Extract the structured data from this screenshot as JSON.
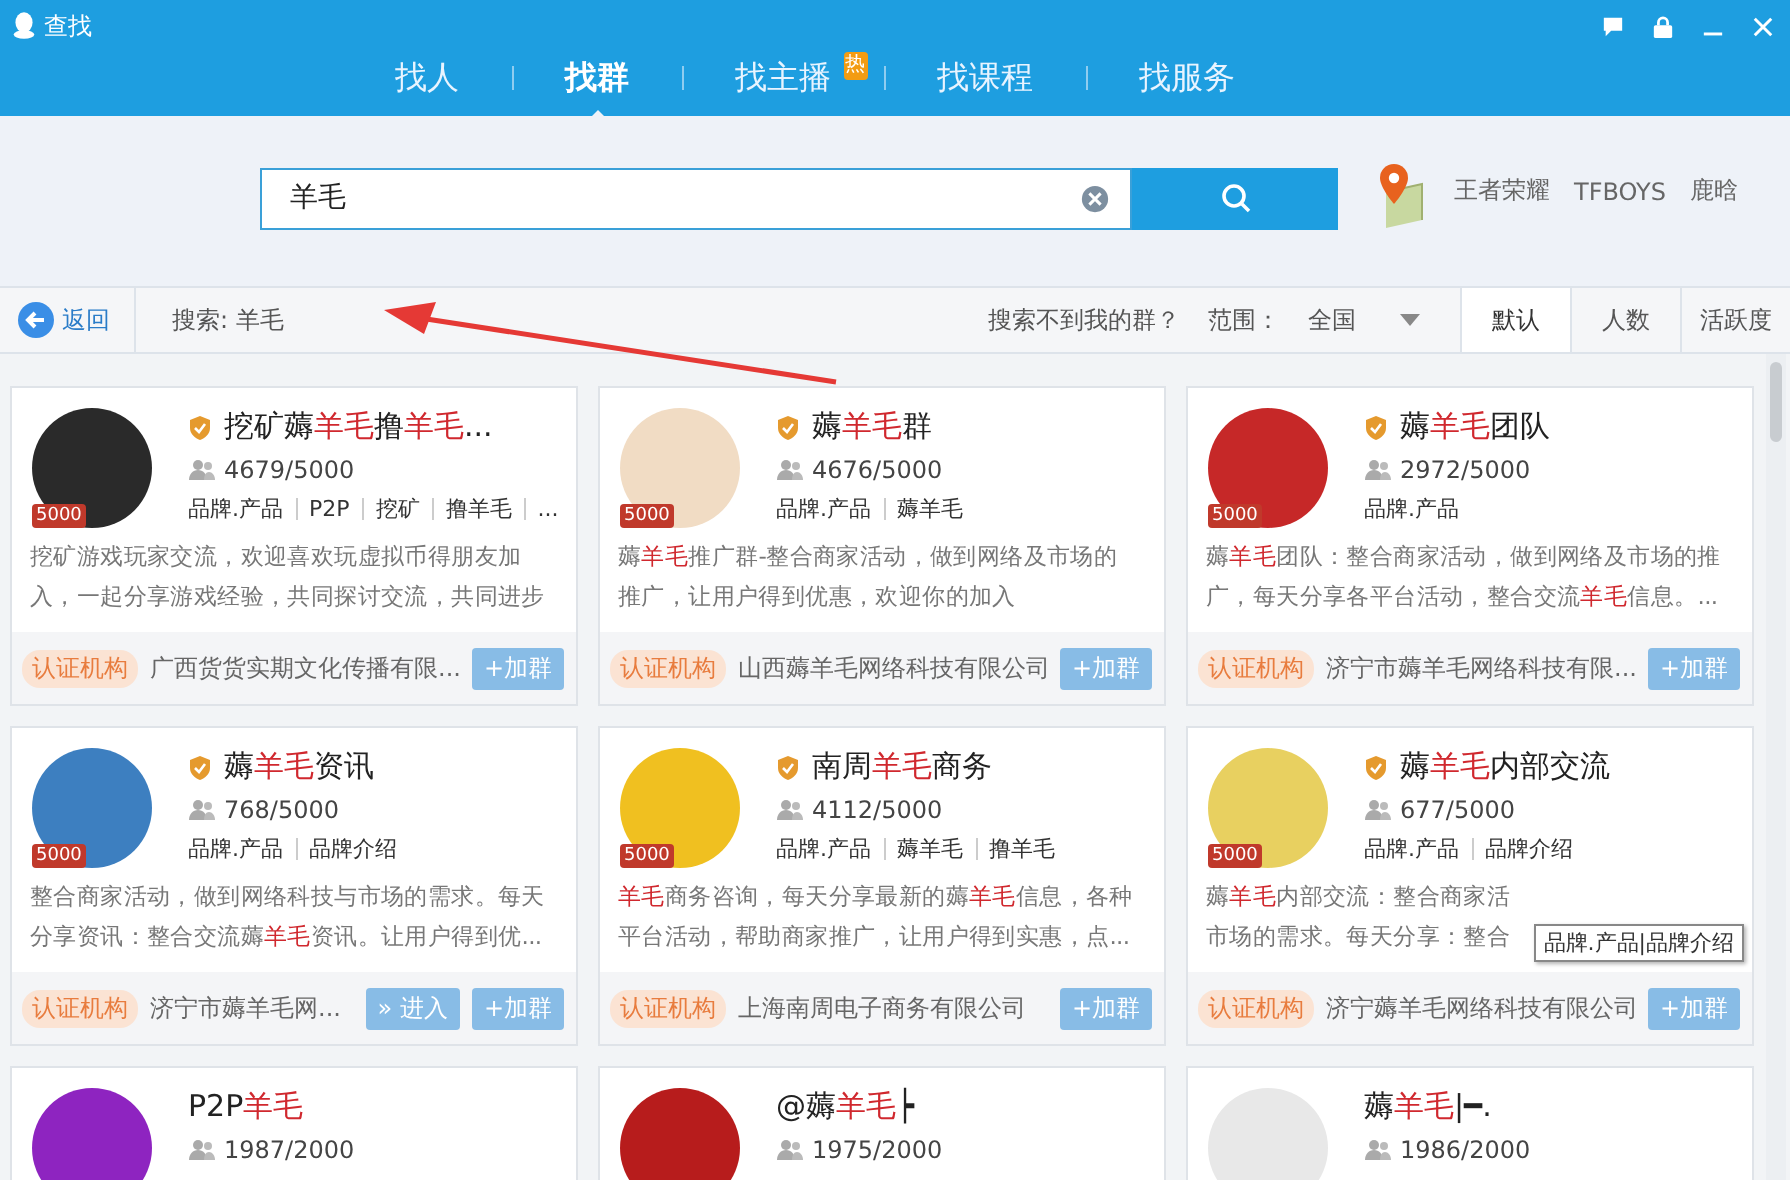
{
  "window": {
    "title": "查找"
  },
  "nav_tabs": [
    {
      "label": "找人",
      "selected": false
    },
    {
      "label": "找群",
      "selected": true
    },
    {
      "label": "找主播",
      "selected": false,
      "badge": "热"
    },
    {
      "label": "找课程",
      "selected": false
    },
    {
      "label": "找服务",
      "selected": false
    }
  ],
  "search": {
    "value": "羊毛"
  },
  "hot_keywords": [
    "王者荣耀",
    "TFBOYS",
    "鹿晗"
  ],
  "toolbar": {
    "back": "返回",
    "query": "搜索: 羊毛",
    "help_link": "搜索不到我的群？",
    "range_label": "范围：",
    "range_value": "全国",
    "sort_tabs": [
      {
        "label": "默认",
        "selected": true
      },
      {
        "label": "人数",
        "selected": false
      },
      {
        "label": "活跃度",
        "selected": false
      }
    ]
  },
  "cards": [
    {
      "name": [
        {
          "text": "挖矿薅",
          "highlight": false
        },
        {
          "text": "羊毛",
          "highlight": true
        },
        {
          "text": "撸",
          "highlight": false
        },
        {
          "text": "羊毛",
          "highlight": true
        },
        {
          "text": "...",
          "highlight": false
        }
      ],
      "verified": true,
      "badge": "5000",
      "members": "4679/5000",
      "tags": [
        "品牌.产品",
        "P2P",
        "挖矿",
        "撸羊毛",
        "..."
      ],
      "description": [
        [
          {
            "text": "挖矿游戏玩家交流，欢迎喜欢玩虚拟币得朋友加",
            "highlight": false
          }
        ],
        [
          {
            "text": "入，一起分享游戏经验，共同探讨交流，共同进步",
            "highlight": false
          }
        ]
      ],
      "org_label": "认证机构",
      "org": "广西货货实期文化传播有限...",
      "buttons": [
        "+加群"
      ]
    },
    {
      "name": [
        {
          "text": "薅",
          "highlight": false
        },
        {
          "text": "羊毛",
          "highlight": true
        },
        {
          "text": "群",
          "highlight": false
        }
      ],
      "verified": true,
      "badge": "5000",
      "members": "4676/5000",
      "tags": [
        "品牌.产品",
        "薅羊毛"
      ],
      "description": [
        [
          {
            "text": "薅",
            "highlight": false
          },
          {
            "text": "羊毛",
            "highlight": true
          },
          {
            "text": "推广群-整合商家活动，做到网络及市场的",
            "highlight": false
          }
        ],
        [
          {
            "text": "推广，让用户得到优惠，欢迎你的加入",
            "highlight": false
          }
        ]
      ],
      "org_label": "认证机构",
      "org": "山西薅羊毛网络科技有限公司",
      "buttons": [
        "+加群"
      ]
    },
    {
      "name": [
        {
          "text": "薅",
          "highlight": false
        },
        {
          "text": "羊毛",
          "highlight": true
        },
        {
          "text": "团队",
          "highlight": false
        }
      ],
      "verified": true,
      "badge": "5000",
      "members": "2972/5000",
      "tags": [
        "品牌.产品"
      ],
      "description": [
        [
          {
            "text": "薅",
            "highlight": false
          },
          {
            "text": "羊毛",
            "highlight": true
          },
          {
            "text": "团队：整合商家活动，做到网络及市场的推",
            "highlight": false
          }
        ],
        [
          {
            "text": "广，每天分享各平台活动，整合交流",
            "highlight": false
          },
          {
            "text": "羊毛",
            "highlight": true
          },
          {
            "text": "信息。...",
            "highlight": false
          }
        ]
      ],
      "org_label": "认证机构",
      "org": "济宁市薅羊毛网络科技有限...",
      "buttons": [
        "+加群"
      ]
    },
    {
      "name": [
        {
          "text": "薅",
          "highlight": false
        },
        {
          "text": "羊毛",
          "highlight": true
        },
        {
          "text": "资讯",
          "highlight": false
        }
      ],
      "verified": true,
      "badge": "5000",
      "members": "768/5000",
      "tags": [
        "品牌.产品",
        "品牌介绍"
      ],
      "description": [
        [
          {
            "text": "整合商家活动，做到网络科技与市场的需求。每天",
            "highlight": false
          }
        ],
        [
          {
            "text": "分享资讯：整合交流薅",
            "highlight": false
          },
          {
            "text": "羊毛",
            "highlight": true
          },
          {
            "text": "资讯。让用户得到优...",
            "highlight": false
          }
        ]
      ],
      "org_label": "认证机构",
      "org": "济宁市薅羊毛网...",
      "buttons": [
        "» 进入",
        "+加群"
      ]
    },
    {
      "name": [
        {
          "text": "南周",
          "highlight": false
        },
        {
          "text": "羊毛",
          "highlight": true
        },
        {
          "text": "商务",
          "highlight": false
        }
      ],
      "verified": true,
      "badge": "5000",
      "members": "4112/5000",
      "tags": [
        "品牌.产品",
        "薅羊毛",
        "撸羊毛"
      ],
      "description": [
        [
          {
            "text": "羊毛",
            "highlight": true
          },
          {
            "text": "商务咨询，每天分享最新的薅",
            "highlight": false
          },
          {
            "text": "羊毛",
            "highlight": true
          },
          {
            "text": "信息，各种",
            "highlight": false
          }
        ],
        [
          {
            "text": "平台活动，帮助商家推广，让用户得到实惠，点...",
            "highlight": false
          }
        ]
      ],
      "org_label": "认证机构",
      "org": "上海南周电子商务有限公司",
      "buttons": [
        "+加群"
      ]
    },
    {
      "name": [
        {
          "text": "薅",
          "highlight": false
        },
        {
          "text": "羊毛",
          "highlight": true
        },
        {
          "text": "内部交流",
          "highlight": false
        }
      ],
      "verified": true,
      "badge": "5000",
      "members": "677/5000",
      "tags": [
        "品牌.产品",
        "品牌介绍"
      ],
      "description": [
        [
          {
            "text": "薅",
            "highlight": false
          },
          {
            "text": "羊毛",
            "highlight": true
          },
          {
            "text": "内部交流：整合商家活",
            "highlight": false
          }
        ],
        [
          {
            "text": "市场的需求。每天分享：整合",
            "highlight": false
          }
        ]
      ],
      "org_label": "认证机构",
      "org": "济宁薅羊毛网络科技有限公司",
      "buttons": [
        "+加群"
      ],
      "tooltip": "品牌.产品|品牌介绍"
    },
    {
      "name": [
        {
          "text": "P2P",
          "highlight": false
        },
        {
          "text": "羊毛",
          "highlight": true
        }
      ],
      "verified": false,
      "members": "1987/2000"
    },
    {
      "name": [
        {
          "text": "@薅",
          "highlight": false
        },
        {
          "text": "羊毛",
          "highlight": true
        },
        {
          "text": "┝",
          "highlight": false
        }
      ],
      "verified": false,
      "members": "1975/2000"
    },
    {
      "name": [
        {
          "text": "薅",
          "highlight": false
        },
        {
          "text": "羊毛",
          "highlight": true
        },
        {
          "text": "|━.",
          "highlight": false
        }
      ],
      "verified": false,
      "members": "1986/2000"
    }
  ]
}
